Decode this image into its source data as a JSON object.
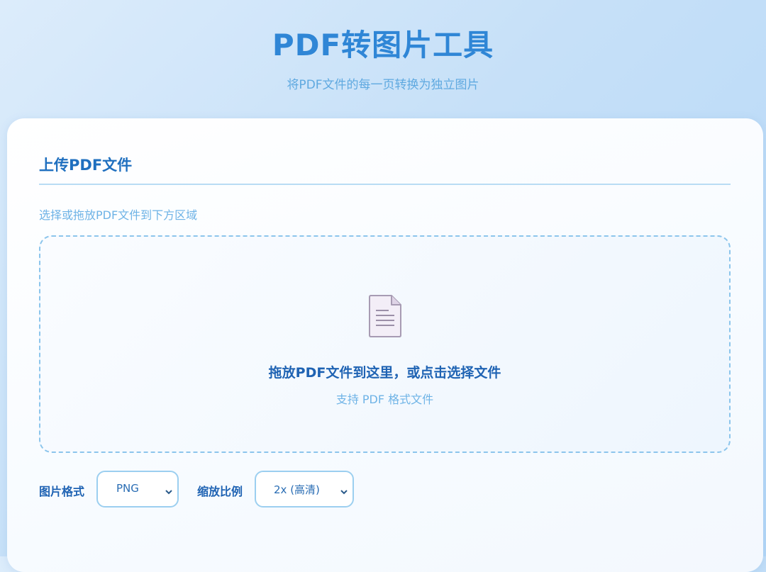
{
  "header": {
    "title": "PDF转图片工具",
    "subtitle": "将PDF文件的每一页转换为独立图片"
  },
  "upload": {
    "section_title": "上传PDF文件",
    "hint": "选择或拖放PDF文件到下方区域",
    "dropzone": {
      "icon": "document-icon",
      "main_text": "拖放PDF文件到这里，或点击选择文件",
      "sub_text": "支持 PDF 格式文件"
    }
  },
  "options": {
    "format": {
      "label": "图片格式",
      "value": "PNG"
    },
    "scale": {
      "label": "缩放比例",
      "value": "2x (高清)"
    }
  },
  "colors": {
    "accent": "#2f86d6",
    "heading": "#1f6fbf",
    "hint": "#6eb3e6",
    "border": "#9ccff0"
  }
}
